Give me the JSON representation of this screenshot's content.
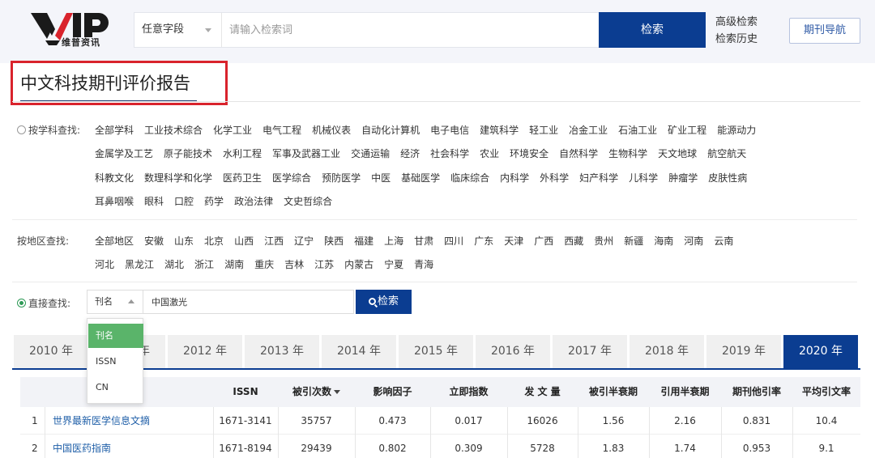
{
  "header": {
    "logo_text": "维普资讯",
    "field_select": "任意字段",
    "search_placeholder": "请输入检索词",
    "search_button": "检索",
    "advanced_search": "高级检索",
    "search_history": "检索历史",
    "journal_nav": "期刊导航"
  },
  "page_title": "中文科技期刊评价报告",
  "subject": {
    "label": "按学科查找:",
    "rows": [
      [
        "全部学科",
        "工业技术综合",
        "化学工业",
        "电气工程",
        "机械仪表",
        "自动化计算机",
        "电子电信",
        "建筑科学",
        "轻工业",
        "冶金工业",
        "石油工业",
        "矿业工程",
        "能源动力"
      ],
      [
        "金属学及工艺",
        "原子能技术",
        "水利工程",
        "军事及武器工业",
        "交通运输",
        "经济",
        "社会科学",
        "农业",
        "环境安全",
        "自然科学",
        "生物科学",
        "天文地球",
        "航空航天"
      ],
      [
        "科教文化",
        "数理科学和化学",
        "医药卫生",
        "医学综合",
        "预防医学",
        "中医",
        "基础医学",
        "临床综合",
        "内科学",
        "外科学",
        "妇产科学",
        "儿科学",
        "肿瘤学",
        "皮肤性病"
      ],
      [
        "耳鼻咽喉",
        "眼科",
        "口腔",
        "药学",
        "政治法律",
        "文史哲综合"
      ]
    ]
  },
  "region": {
    "label": "按地区查找:",
    "rows": [
      [
        "全部地区",
        "安徽",
        "山东",
        "北京",
        "山西",
        "江西",
        "辽宁",
        "陕西",
        "福建",
        "上海",
        "甘肃",
        "四川",
        "广东",
        "天津",
        "广西",
        "西藏",
        "贵州",
        "新疆",
        "海南",
        "河南",
        "云南"
      ],
      [
        "河北",
        "黑龙江",
        "湖北",
        "浙江",
        "湖南",
        "重庆",
        "吉林",
        "江苏",
        "内蒙古",
        "宁夏",
        "青海"
      ]
    ]
  },
  "direct": {
    "label": "直接查找:",
    "select_value": "刊名",
    "input_value": "中国激光",
    "button": "检索",
    "options": [
      "刊名",
      "ISSN",
      "CN"
    ]
  },
  "years": [
    "2010 年",
    "2011 年",
    "2012 年",
    "2013 年",
    "2014 年",
    "2015 年",
    "2016 年",
    "2017 年",
    "2018 年",
    "2019 年",
    "2020 年"
  ],
  "active_year": "2020 年",
  "table": {
    "headers": [
      "ISSN",
      "被引次数",
      "影响因子",
      "立即指数",
      "发 文 量",
      "被引半衰期",
      "引用半衰期",
      "期刊他引率",
      "平均引文率"
    ],
    "rows": [
      {
        "idx": "1",
        "name": "世界最新医学信息文摘",
        "cells": [
          "1671-3141",
          "35757",
          "0.473",
          "0.017",
          "16026",
          "1.56",
          "2.16",
          "0.831",
          "10.4"
        ]
      },
      {
        "idx": "2",
        "name": "中国医药指南",
        "cells": [
          "1671-8194",
          "29439",
          "0.802",
          "0.309",
          "5728",
          "1.83",
          "1.74",
          "0.953",
          "9.1"
        ]
      }
    ]
  },
  "colors": {
    "primary": "#0b3d91",
    "highlight_box": "#d9232c",
    "link": "#1f5fa8",
    "selected_option": "#5ab46a"
  }
}
